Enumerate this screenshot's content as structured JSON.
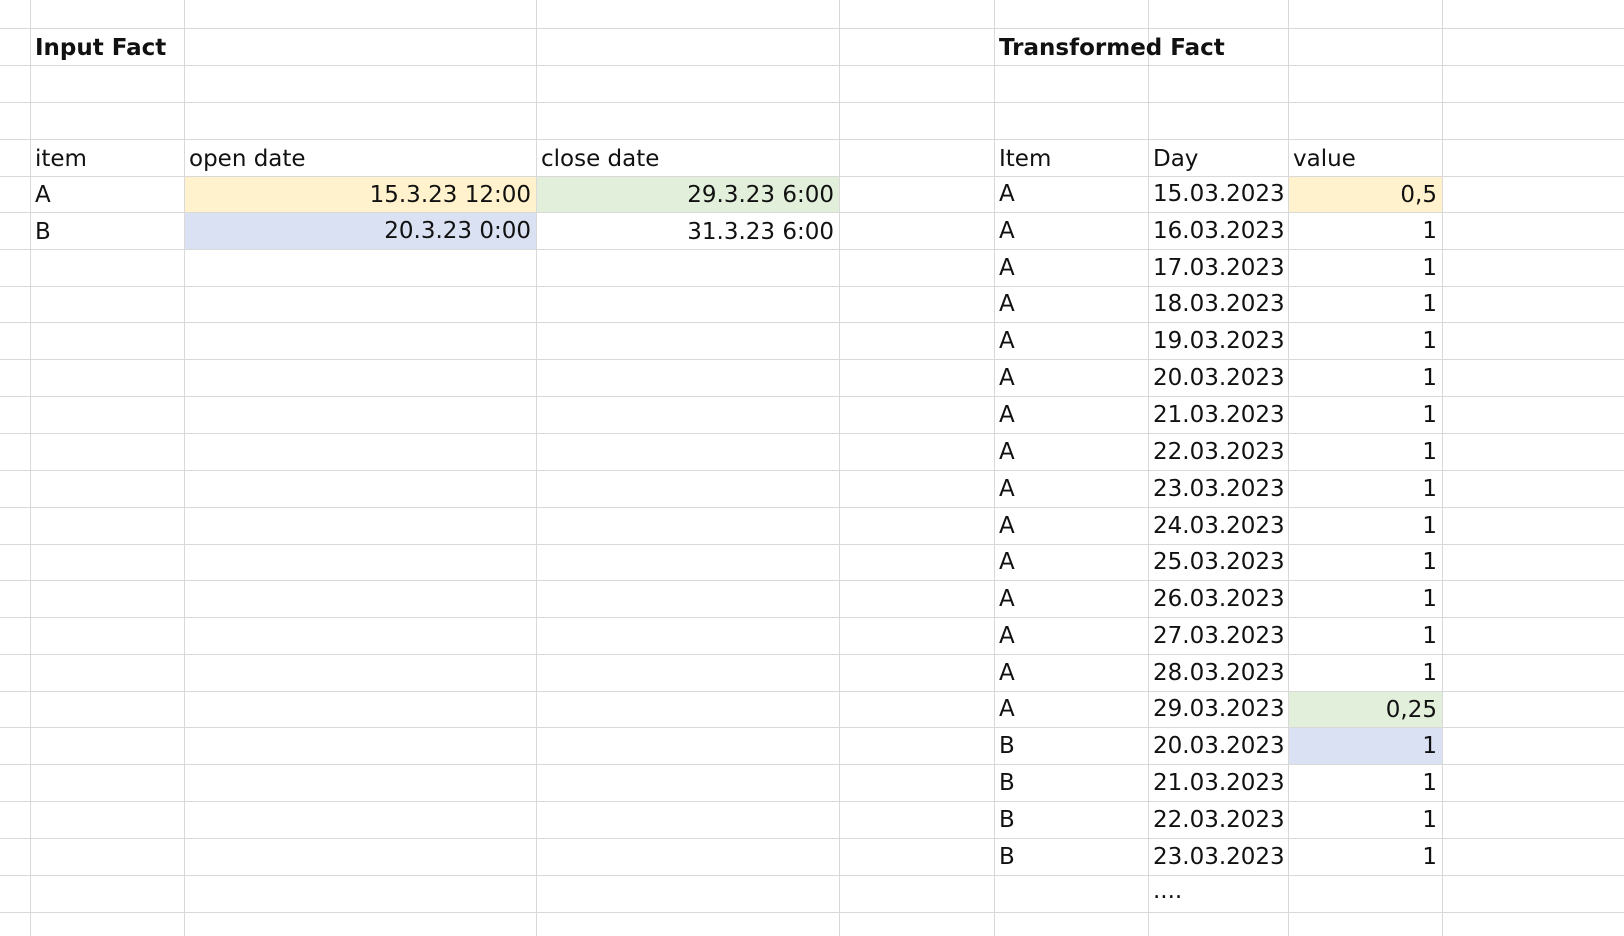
{
  "colors": {
    "gridline": "#d9d9d9",
    "highlight_yellow": "#fff2cc",
    "highlight_green": "#e2efda",
    "highlight_blue": "#d9e1f2"
  },
  "input_fact": {
    "title": "Input Fact",
    "headers": {
      "item": "item",
      "open_date": "open date",
      "close_date": "close date"
    },
    "rows": [
      {
        "item": "A",
        "open_date": "15.3.23 12:00",
        "close_date": "29.3.23 6:00"
      },
      {
        "item": "B",
        "open_date": "20.3.23 0:00",
        "close_date": "31.3.23 6:00"
      }
    ]
  },
  "transformed_fact": {
    "title": "Transformed Fact",
    "headers": {
      "item": "Item",
      "day": "Day",
      "value": "value"
    },
    "rows": [
      {
        "item": "A",
        "day": "15.03.2023",
        "value": "0,5"
      },
      {
        "item": "A",
        "day": "16.03.2023",
        "value": "1"
      },
      {
        "item": "A",
        "day": "17.03.2023",
        "value": "1"
      },
      {
        "item": "A",
        "day": "18.03.2023",
        "value": "1"
      },
      {
        "item": "A",
        "day": "19.03.2023",
        "value": "1"
      },
      {
        "item": "A",
        "day": "20.03.2023",
        "value": "1"
      },
      {
        "item": "A",
        "day": "21.03.2023",
        "value": "1"
      },
      {
        "item": "A",
        "day": "22.03.2023",
        "value": "1"
      },
      {
        "item": "A",
        "day": "23.03.2023",
        "value": "1"
      },
      {
        "item": "A",
        "day": "24.03.2023",
        "value": "1"
      },
      {
        "item": "A",
        "day": "25.03.2023",
        "value": "1"
      },
      {
        "item": "A",
        "day": "26.03.2023",
        "value": "1"
      },
      {
        "item": "A",
        "day": "27.03.2023",
        "value": "1"
      },
      {
        "item": "A",
        "day": "28.03.2023",
        "value": "1"
      },
      {
        "item": "A",
        "day": "29.03.2023",
        "value": "0,25"
      },
      {
        "item": "B",
        "day": "20.03.2023",
        "value": "1"
      },
      {
        "item": "B",
        "day": "21.03.2023",
        "value": "1"
      },
      {
        "item": "B",
        "day": "22.03.2023",
        "value": "1"
      },
      {
        "item": "B",
        "day": "23.03.2023",
        "value": "1"
      }
    ],
    "continuation": "...."
  }
}
